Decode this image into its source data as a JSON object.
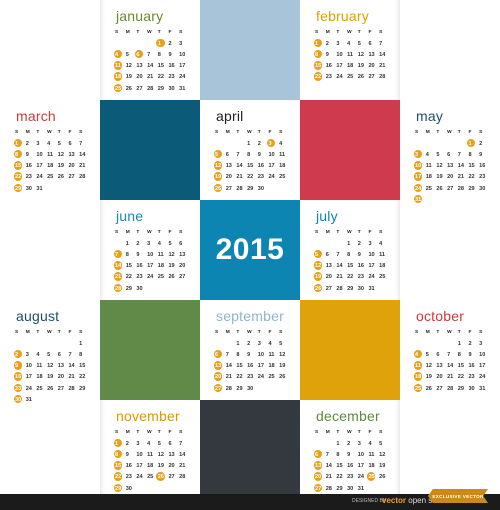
{
  "year": "2015",
  "weekday_headers": [
    "S",
    "M",
    "T",
    "W",
    "T",
    "F",
    "S"
  ],
  "colors": {
    "light_blue": "#a7c4d8",
    "teal_dark": "#0b5a77",
    "crimson": "#cf3a4f",
    "blue": "#0d85b3",
    "green": "#618a48",
    "mustard": "#e0a20b",
    "charcoal": "#33393f",
    "highlight": "#e5a11c"
  },
  "months": [
    {
      "name": "january",
      "color": "#6a8a2a",
      "weeks": [
        [
          "",
          "",
          "",
          "",
          "1",
          "2",
          "3"
        ],
        [
          "4",
          "5",
          "6",
          "7",
          "8",
          "9",
          "10"
        ],
        [
          "11",
          "12",
          "13",
          "14",
          "15",
          "16",
          "17"
        ],
        [
          "18",
          "19",
          "20",
          "21",
          "22",
          "23",
          "24"
        ],
        [
          "25",
          "26",
          "27",
          "28",
          "29",
          "30",
          "31"
        ]
      ],
      "highlights": [
        "1",
        "4",
        "6",
        "11",
        "18",
        "25"
      ]
    },
    {
      "name": "february",
      "color": "#d7a100",
      "weeks": [
        [
          "1",
          "2",
          "3",
          "4",
          "5",
          "6",
          "7"
        ],
        [
          "8",
          "9",
          "10",
          "11",
          "12",
          "13",
          "14"
        ],
        [
          "15",
          "16",
          "17",
          "18",
          "19",
          "20",
          "21"
        ],
        [
          "22",
          "23",
          "24",
          "25",
          "26",
          "27",
          "28"
        ]
      ],
      "highlights": [
        "1",
        "8",
        "15",
        "22"
      ]
    },
    {
      "name": "march",
      "color": "#c93c3c",
      "weeks": [
        [
          "1",
          "2",
          "3",
          "4",
          "5",
          "6",
          "7"
        ],
        [
          "8",
          "9",
          "10",
          "11",
          "12",
          "13",
          "14"
        ],
        [
          "15",
          "16",
          "17",
          "18",
          "19",
          "20",
          "21"
        ],
        [
          "22",
          "23",
          "24",
          "25",
          "26",
          "27",
          "28"
        ],
        [
          "29",
          "30",
          "31",
          "",
          "",
          "",
          ""
        ]
      ],
      "highlights": [
        "1",
        "8",
        "15",
        "22",
        "29"
      ]
    },
    {
      "name": "april",
      "color": "#1e1e1e",
      "weeks": [
        [
          "",
          "",
          "",
          "1",
          "2",
          "3",
          "4"
        ],
        [
          "5",
          "6",
          "7",
          "8",
          "9",
          "10",
          "11"
        ],
        [
          "12",
          "13",
          "14",
          "15",
          "16",
          "17",
          "18"
        ],
        [
          "19",
          "20",
          "21",
          "22",
          "23",
          "24",
          "25"
        ],
        [
          "26",
          "27",
          "28",
          "29",
          "30",
          "",
          ""
        ]
      ],
      "highlights": [
        "3",
        "5",
        "12",
        "19",
        "26"
      ]
    },
    {
      "name": "may",
      "color": "#1b4e66",
      "weeks": [
        [
          "",
          "",
          "",
          "",
          "",
          "1",
          "2"
        ],
        [
          "3",
          "4",
          "5",
          "6",
          "7",
          "8",
          "9"
        ],
        [
          "10",
          "11",
          "12",
          "13",
          "14",
          "15",
          "16"
        ],
        [
          "17",
          "18",
          "19",
          "20",
          "21",
          "22",
          "23"
        ],
        [
          "24",
          "25",
          "26",
          "27",
          "28",
          "29",
          "30"
        ],
        [
          "31",
          "",
          "",
          "",
          "",
          "",
          ""
        ]
      ],
      "highlights": [
        "1",
        "3",
        "10",
        "17",
        "24",
        "31"
      ]
    },
    {
      "name": "june",
      "color": "#1a8ab3",
      "weeks": [
        [
          "",
          "1",
          "2",
          "3",
          "4",
          "5",
          "6"
        ],
        [
          "7",
          "8",
          "9",
          "10",
          "11",
          "12",
          "13"
        ],
        [
          "14",
          "15",
          "16",
          "17",
          "18",
          "19",
          "20"
        ],
        [
          "21",
          "22",
          "23",
          "24",
          "25",
          "26",
          "27"
        ],
        [
          "28",
          "29",
          "30",
          "",
          "",
          "",
          ""
        ]
      ],
      "highlights": [
        "7",
        "14",
        "21",
        "28"
      ]
    },
    {
      "name": "july",
      "color": "#0d85b3",
      "weeks": [
        [
          "",
          "",
          "",
          "1",
          "2",
          "3",
          "4"
        ],
        [
          "5",
          "6",
          "7",
          "8",
          "9",
          "10",
          "11"
        ],
        [
          "12",
          "13",
          "14",
          "15",
          "16",
          "17",
          "18"
        ],
        [
          "19",
          "20",
          "21",
          "22",
          "23",
          "24",
          "25"
        ],
        [
          "26",
          "27",
          "28",
          "29",
          "30",
          "31",
          ""
        ]
      ],
      "highlights": [
        "5",
        "12",
        "19",
        "26"
      ]
    },
    {
      "name": "august",
      "color": "#1b4e66",
      "weeks": [
        [
          "",
          "",
          "",
          "",
          "",
          "",
          "1"
        ],
        [
          "2",
          "3",
          "4",
          "5",
          "6",
          "7",
          "8"
        ],
        [
          "9",
          "10",
          "11",
          "12",
          "13",
          "14",
          "15"
        ],
        [
          "16",
          "17",
          "18",
          "19",
          "20",
          "21",
          "22"
        ],
        [
          "23",
          "24",
          "25",
          "26",
          "27",
          "28",
          "29"
        ],
        [
          "30",
          "31",
          "",
          "",
          "",
          "",
          ""
        ]
      ],
      "highlights": [
        "2",
        "9",
        "16",
        "23",
        "30"
      ]
    },
    {
      "name": "september",
      "color": "#8fb5cc",
      "weeks": [
        [
          "",
          "",
          "1",
          "2",
          "3",
          "4",
          "5"
        ],
        [
          "6",
          "7",
          "8",
          "9",
          "10",
          "11",
          "12"
        ],
        [
          "13",
          "14",
          "15",
          "16",
          "17",
          "18",
          "19"
        ],
        [
          "20",
          "21",
          "22",
          "23",
          "24",
          "25",
          "26"
        ],
        [
          "27",
          "28",
          "29",
          "30",
          "",
          "",
          ""
        ]
      ],
      "highlights": [
        "6",
        "13",
        "20",
        "27"
      ]
    },
    {
      "name": "october",
      "color": "#c93c3c",
      "weeks": [
        [
          "",
          "",
          "",
          "",
          "1",
          "2",
          "3"
        ],
        [
          "4",
          "5",
          "6",
          "7",
          "8",
          "9",
          "10"
        ],
        [
          "11",
          "12",
          "13",
          "14",
          "15",
          "16",
          "17"
        ],
        [
          "18",
          "19",
          "20",
          "21",
          "22",
          "23",
          "24"
        ],
        [
          "25",
          "26",
          "27",
          "28",
          "29",
          "30",
          "31"
        ]
      ],
      "highlights": [
        "4",
        "11",
        "18",
        "25"
      ]
    },
    {
      "name": "november",
      "color": "#d79a00",
      "weeks": [
        [
          "1",
          "2",
          "3",
          "4",
          "5",
          "6",
          "7"
        ],
        [
          "8",
          "9",
          "10",
          "11",
          "12",
          "13",
          "14"
        ],
        [
          "15",
          "16",
          "17",
          "18",
          "19",
          "20",
          "21"
        ],
        [
          "22",
          "23",
          "24",
          "25",
          "26",
          "27",
          "28"
        ],
        [
          "29",
          "30",
          "",
          "",
          "",
          "",
          ""
        ]
      ],
      "highlights": [
        "1",
        "8",
        "15",
        "22",
        "26",
        "29"
      ]
    },
    {
      "name": "december",
      "color": "#5c8a3a",
      "weeks": [
        [
          "",
          "",
          "1",
          "2",
          "3",
          "4",
          "5"
        ],
        [
          "6",
          "7",
          "8",
          "9",
          "10",
          "11",
          "12"
        ],
        [
          "13",
          "14",
          "15",
          "16",
          "17",
          "18",
          "19"
        ],
        [
          "20",
          "21",
          "22",
          "23",
          "24",
          "25",
          "26"
        ],
        [
          "27",
          "28",
          "29",
          "30",
          "31",
          "",
          ""
        ]
      ],
      "highlights": [
        "6",
        "13",
        "20",
        "25",
        "27"
      ]
    }
  ],
  "footer": {
    "source_text": "DESIGNED BY",
    "brand_prefix": "vector",
    "brand_suffix": "open stock",
    "ribbon_text": "EXCLUSIVE VECTOR"
  }
}
